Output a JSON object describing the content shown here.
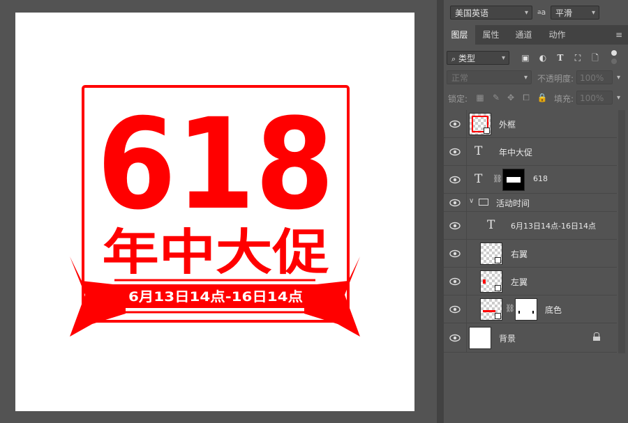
{
  "artwork": {
    "big_number": "618",
    "headline": "年中大促",
    "ribbon_text": "6月13日14点-16日14点",
    "accent_color": "#ff0000",
    "frame_color": "#ff0000"
  },
  "character_panel": {
    "language": "美国英语",
    "aa_label": "a",
    "antialias": "平滑"
  },
  "tabs": [
    {
      "label": "图层",
      "active": true
    },
    {
      "label": "属性",
      "active": false
    },
    {
      "label": "通道",
      "active": false
    },
    {
      "label": "动作",
      "active": false
    }
  ],
  "panel_menu_icon": "≡",
  "filter": {
    "kind_label": "类型",
    "icons": [
      "image-filter-icon",
      "adjustment-filter-icon",
      "type-filter-icon",
      "shape-filter-icon",
      "smart-object-filter-icon",
      "toggle-filter-icon"
    ]
  },
  "blend": {
    "mode": "正常",
    "opacity_label": "不透明度:",
    "opacity_value": "100%",
    "lock_label": "锁定:",
    "fill_label": "填充:",
    "fill_value": "100%"
  },
  "layers": [
    {
      "name": "外框",
      "kind": "smart"
    },
    {
      "name": "年中大促",
      "kind": "text"
    },
    {
      "name": "618",
      "kind": "text-masked"
    },
    {
      "name": "活动时间",
      "kind": "group"
    },
    {
      "name": "6月13日14点-16日14点",
      "kind": "text-indented"
    },
    {
      "name": "右翼",
      "kind": "smart-indented"
    },
    {
      "name": "左翼",
      "kind": "smart-indented"
    },
    {
      "name": "底色",
      "kind": "smart-masked"
    },
    {
      "name": "背景",
      "kind": "background",
      "locked": true
    }
  ],
  "colors": {
    "panel_bg": "#535353",
    "dark_bg": "#424242",
    "text": "#e8e8e8"
  }
}
